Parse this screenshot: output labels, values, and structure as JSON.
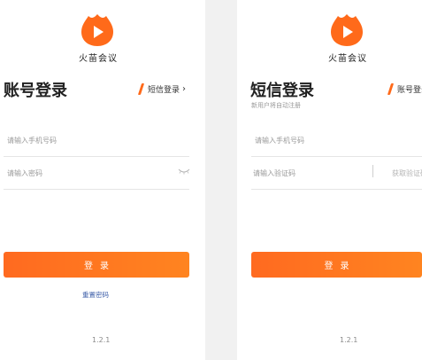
{
  "app": {
    "name": "火苗会议",
    "version": "1.2.1",
    "accent_color": "#ff6a1a",
    "link_color": "#3d5ea8"
  },
  "account_login": {
    "title": "账号登录",
    "switch_label": "短信登录",
    "phone_placeholder": "请输入手机号码",
    "password_placeholder": "请输入密码",
    "login_label": "登录",
    "reset_label": "重置密码",
    "icons": {
      "logo": "app-logo-icon",
      "eye": "eye-closed-icon",
      "chevron": "chevron-right-icon"
    }
  },
  "sms_login": {
    "title": "短信登录",
    "subtitle": "新用户将自动注册",
    "switch_label": "账号登录",
    "phone_placeholder": "请输入手机号码",
    "code_placeholder": "请输入验证码",
    "get_code_label": "获取验证码",
    "login_label": "登录"
  }
}
